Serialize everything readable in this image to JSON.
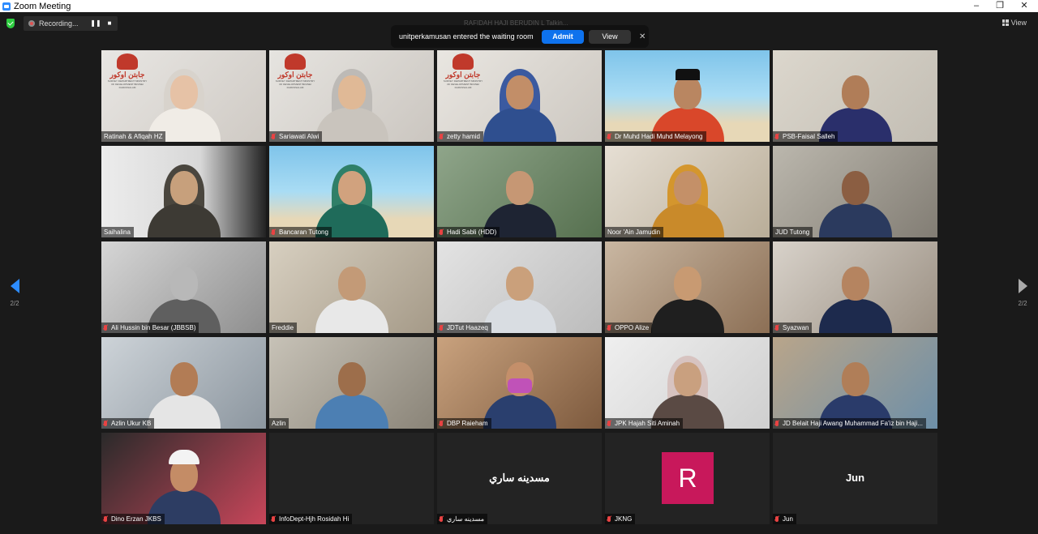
{
  "window": {
    "title": "Zoom Meeting",
    "controls": [
      "–",
      "❐",
      "✕"
    ]
  },
  "topbar": {
    "recording_label": "Recording...",
    "pause_symbol": "❚❚",
    "stop_symbol": "■",
    "view_label": "View",
    "active_speaker": "RAFIDAH HAJI BERUDIN L Talkin..."
  },
  "waiting_room": {
    "message": "unitperkamusan entered the waiting room",
    "admit_label": "Admit",
    "view_label": "View",
    "close_symbol": "✕"
  },
  "pager": {
    "left": "2/2",
    "right": "2/2"
  },
  "logo": {
    "arabic": "جابتن اوكور",
    "sub": "SURVEY DEPARTMENT MINISTRY OF DEVELOPMENT BRUNEI DARUSSALAM"
  },
  "participants": [
    {
      "name": "Ratinah & Afiqah HZ",
      "muted": false
    },
    {
      "name": "Sariawati Alwi",
      "muted": true
    },
    {
      "name": "zetty hamid",
      "muted": true
    },
    {
      "name": "Dr Muhd Hadi Muhd Melayong",
      "muted": true
    },
    {
      "name": "PSB-Faisal Salleh",
      "muted": true
    },
    {
      "name": "Saihalina",
      "muted": false
    },
    {
      "name": "Bancaran Tutong",
      "muted": true
    },
    {
      "name": "Hadi Sabli (HDD)",
      "muted": true
    },
    {
      "name": "Noor 'Ain Jamudin",
      "muted": false
    },
    {
      "name": "JUD Tutong",
      "muted": false
    },
    {
      "name": "Ali Hussin bin Besar (JBBSB)",
      "muted": true
    },
    {
      "name": "Freddie",
      "muted": false
    },
    {
      "name": "JDTut Haazeq",
      "muted": true
    },
    {
      "name": "OPPO Alize",
      "muted": true
    },
    {
      "name": "Syazwan",
      "muted": true
    },
    {
      "name": "Azlin Ukur KB",
      "muted": true
    },
    {
      "name": "Azlin",
      "muted": false
    },
    {
      "name": "DBP Raieham",
      "muted": true
    },
    {
      "name": "JPK Hajah Siti Aminah",
      "muted": true
    },
    {
      "name": "JD Belait Haji Awang Muhammad Fa'iz bin Haji...",
      "muted": true
    },
    {
      "name": "Dino Erzan JKBS",
      "muted": true
    },
    {
      "name": "InfoDept-Hjh Rosidah Hi",
      "muted": true
    },
    {
      "name": "مسدينه ساري",
      "muted": true
    },
    {
      "name": "JKNG",
      "muted": true
    },
    {
      "name": "Jun",
      "muted": true
    }
  ],
  "tiles_text": {
    "masdinah_display": "مسدينه ساري",
    "jkng_initial": "R",
    "jun_display": "Jun"
  },
  "colors": {
    "admit_blue": "#0e72ed",
    "avatar_magenta": "#c8185b",
    "muted_red": "#e84343",
    "nav_active": "#2d8cff"
  }
}
